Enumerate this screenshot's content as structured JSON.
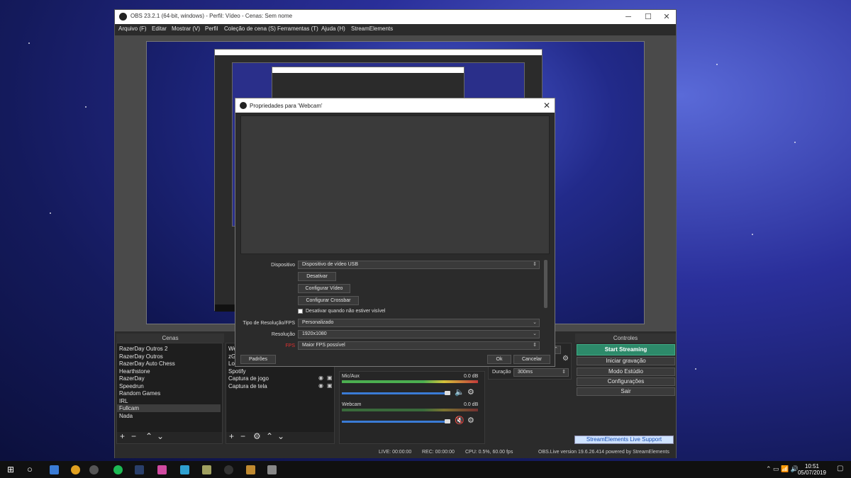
{
  "window": {
    "title": "OBS 23.2.1 (64-bit, windows) - Perfil: Vídeo - Cenas: Sem nome"
  },
  "menu": [
    "Arquivo (F)",
    "Editar",
    "Mostrar (V)",
    "Perfil",
    "Coleção de cena (S)",
    "Ferramentas (T)",
    "Ajuda (H)",
    "StreamElements"
  ],
  "docks": {
    "scenes_title": "Cenas",
    "controls_title": "Controles"
  },
  "scenes": [
    "RazerDay Outros 2",
    "RazerDay Outros",
    "RazerDay Auto Chess",
    "Hearthstone",
    "RazerDay",
    "Speedrun",
    "Random Games",
    "IRL",
    "Fullcam",
    "Nada"
  ],
  "sources": [
    "Web",
    "zGo",
    "Loo",
    "Spotify",
    "Captura de jogo",
    "Captura de tela"
  ],
  "mixer": {
    "channels": [
      {
        "name": "Mic/Aux",
        "db": "0.0 dB"
      },
      {
        "name": "Webcam",
        "db": "0.0 dB"
      }
    ],
    "ticks": [
      "-60",
      "-55",
      "-50",
      "-45",
      "-40",
      "-35",
      "-30",
      "-25",
      "-20",
      "-15",
      "-10",
      "-5",
      "0"
    ]
  },
  "transition": {
    "duration_label": "Duração",
    "duration_value": "300ms"
  },
  "controls": [
    "Start Streaming",
    "Iniciar gravação",
    "Modo Estúdio",
    "Configurações",
    "Sair"
  ],
  "streamelements_support": "StreamElements Live Support",
  "status": {
    "live": "LIVE: 00:00:00",
    "rec": "REC: 00:00:00",
    "cpu": "CPU: 0.5%, 60.00 fps",
    "version": "OBS.Live version 19.6.26.414 powered by StreamElements"
  },
  "dialog": {
    "title": "Propriedades para 'Webcam'",
    "device_label": "Dispositivo",
    "device_value": "Dispositivo de vídeo USB",
    "btn_deactivate": "Desativar",
    "btn_config_video": "Configurar Vídeo",
    "btn_config_crossbar": "Configurar Crossbar",
    "checkbox_label": "Desativar quando não estiver visível",
    "res_fps_label": "Tipo de Resolução/FPS",
    "res_fps_value": "Personalizado",
    "resolution_label": "Resolução",
    "resolution_value": "1920x1080",
    "fps_label": "FPS",
    "fps_value": "Maior FPS possível",
    "defaults": "Padrões",
    "ok": "Ok",
    "cancel": "Cancelar"
  },
  "taskbar": {
    "time": "10:51",
    "date": "05/07/2019"
  },
  "colors": {
    "accent_stream": "#2d8a6a",
    "fps_label": "#e03030"
  }
}
